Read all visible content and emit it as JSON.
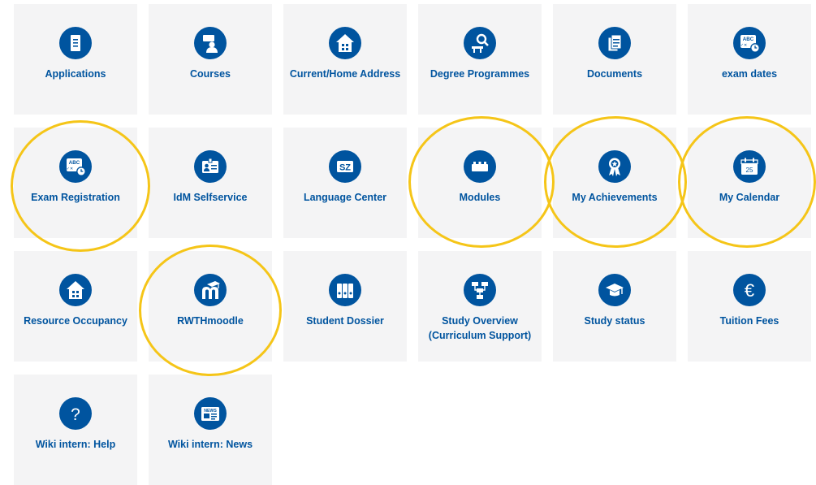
{
  "tiles": [
    {
      "label": "Applications",
      "icon": "document-icon"
    },
    {
      "label": "Courses",
      "icon": "teacher-icon"
    },
    {
      "label": "Current/Home Address",
      "icon": "house-icon"
    },
    {
      "label": "Degree Programmes",
      "icon": "magnifier-desk-icon"
    },
    {
      "label": "Documents",
      "icon": "documents-icon"
    },
    {
      "label": "exam dates",
      "icon": "abc-clock-icon"
    },
    {
      "label": "Exam Registration",
      "icon": "abc-clock-icon"
    },
    {
      "label": "IdM Selfservice",
      "icon": "id-card-icon"
    },
    {
      "label": "Language Center",
      "icon": "sz-icon"
    },
    {
      "label": "Modules",
      "icon": "brick-icon"
    },
    {
      "label": "My Achievements",
      "icon": "award-icon"
    },
    {
      "label": "My Calendar",
      "icon": "calendar-icon",
      "calendar_day": "25"
    },
    {
      "label": "Resource Occupancy",
      "icon": "house-icon"
    },
    {
      "label": "RWTHmoodle",
      "icon": "moodle-icon"
    },
    {
      "label": "Student Dossier",
      "icon": "binders-icon"
    },
    {
      "label": "Study Overview (Curriculum Support)",
      "icon": "flowchart-icon"
    },
    {
      "label": "Study status",
      "icon": "graduation-cap-icon"
    },
    {
      "label": "Tuition Fees",
      "icon": "euro-icon"
    },
    {
      "label": "Wiki intern: Help",
      "icon": "question-icon"
    },
    {
      "label": "Wiki intern: News",
      "icon": "newspaper-icon",
      "badge_text": "NEWS"
    }
  ],
  "icon_texts": {
    "abc": "ABC",
    "sz": "SZ",
    "question": "?",
    "euro": "€"
  },
  "colors": {
    "tile_bg": "#f4f4f5",
    "icon_bg": "#00549f",
    "label": "#00549f",
    "highlight_ring": "#f5c518"
  },
  "highlighted": [
    "Exam Registration",
    "Modules",
    "My Achievements",
    "My Calendar",
    "RWTHmoodle"
  ]
}
